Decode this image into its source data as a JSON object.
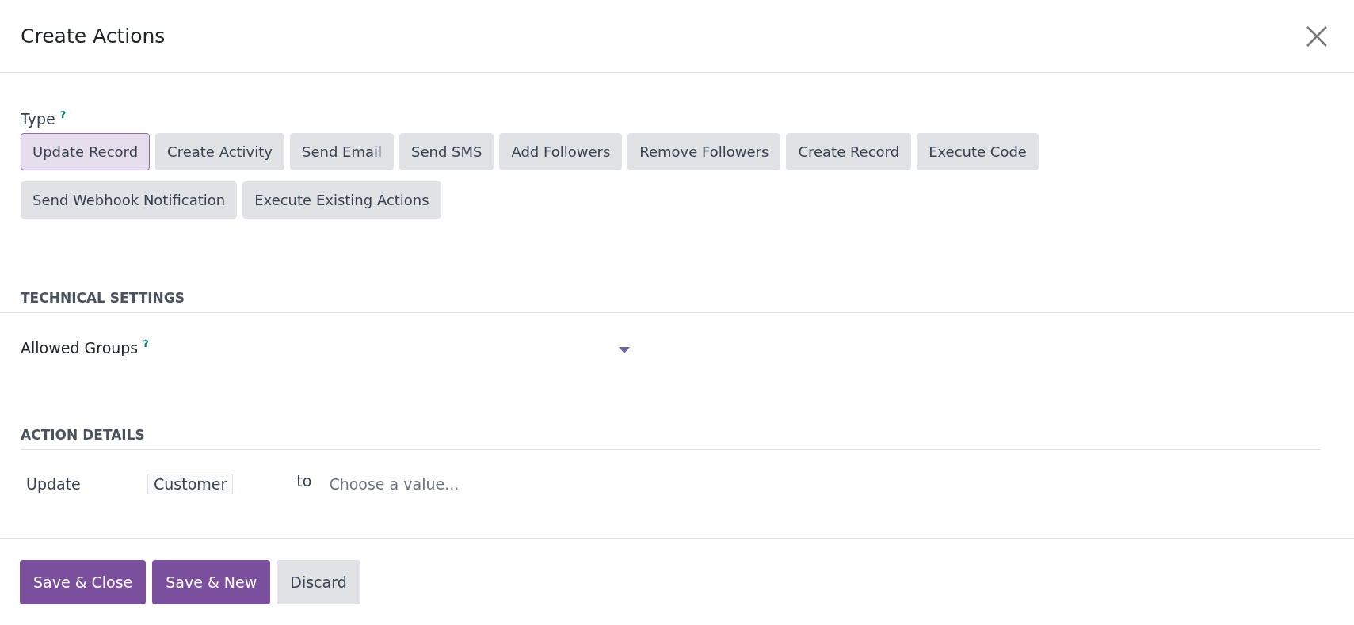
{
  "dialog": {
    "title": "Create Actions"
  },
  "type_field": {
    "label": "Type",
    "help": "?",
    "options": [
      {
        "label": "Update Record",
        "selected": true
      },
      {
        "label": "Create Activity",
        "selected": false
      },
      {
        "label": "Send Email",
        "selected": false
      },
      {
        "label": "Send SMS",
        "selected": false
      },
      {
        "label": "Add Followers",
        "selected": false
      },
      {
        "label": "Remove Followers",
        "selected": false
      },
      {
        "label": "Create Record",
        "selected": false
      },
      {
        "label": "Execute Code",
        "selected": false
      },
      {
        "label": "Send Webhook Notification",
        "selected": false
      },
      {
        "label": "Execute Existing Actions",
        "selected": false
      }
    ]
  },
  "technical_settings": {
    "heading": "TECHNICAL SETTINGS",
    "allowed_groups": {
      "label": "Allowed Groups",
      "help": "?"
    }
  },
  "action_details": {
    "heading": "ACTION DETAILS",
    "update_label": "Update",
    "field_value": "Customer",
    "to_label": "to",
    "value_placeholder": "Choose a value..."
  },
  "footer_buttons": [
    {
      "label": "Save & Close",
      "kind": "primary"
    },
    {
      "label": "Save & New",
      "kind": "primary"
    },
    {
      "label": "Discard",
      "kind": "secondary"
    }
  ]
}
